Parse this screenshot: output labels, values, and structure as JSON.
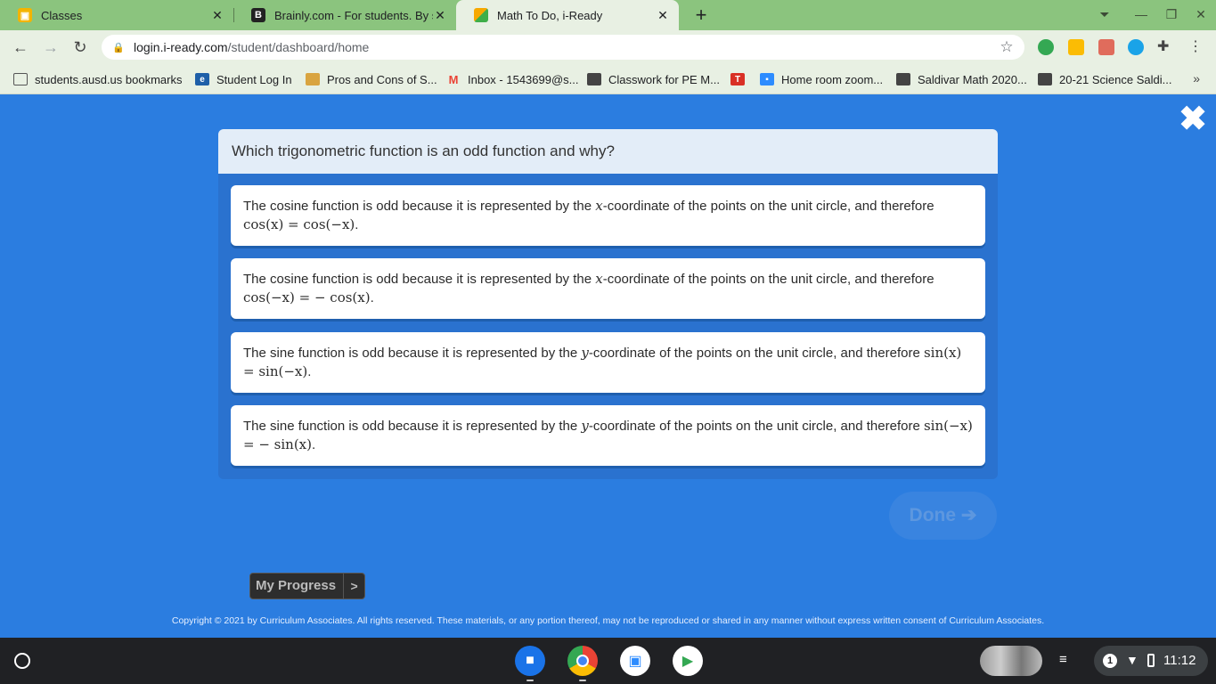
{
  "browser": {
    "tabs": [
      {
        "title": "Classes",
        "active": false
      },
      {
        "title": "Brainly.com - For students. By st",
        "active": false
      },
      {
        "title": "Math To Do, i-Ready",
        "active": true
      }
    ],
    "new_tab": "+",
    "url_host": "login.i-ready.com",
    "url_path": "/student/dashboard/home"
  },
  "bookmarks": [
    "students.ausd.us bookmarks",
    "Student Log In",
    "Pros and Cons of S...",
    "Inbox - 1543699@s...",
    "Classwork for PE M...",
    "",
    "Home room zoom...",
    "Saldivar Math 2020...",
    "20-21 Science Saldi..."
  ],
  "bookmarks_more": "»",
  "question": {
    "prompt": "Which trigonometric function is an odd function and why?",
    "options": [
      {
        "text": "The cosine function is odd because it is represented by the ",
        "var": "x",
        "rest": "-coordinate of the points on the unit circle, and therefore ",
        "math": "cos(x) = cos(−x)",
        "end": "."
      },
      {
        "text": "The cosine function is odd because it is represented by the ",
        "var": "x",
        "rest": "-coordinate of the points on the unit circle, and therefore ",
        "math": "cos(−x) = − cos(x)",
        "end": "."
      },
      {
        "text": "The sine function is odd because it is represented by the ",
        "var": "y",
        "rest": "-coordinate of the points on the unit circle, and therefore ",
        "math": "sin(x) = sin(−x)",
        "end": "."
      },
      {
        "text": "The sine function is odd because it is represented by the ",
        "var": "y",
        "rest": "-coordinate of the points on the unit circle, and therefore ",
        "math": "sin(−x) = − sin(x)",
        "end": "."
      }
    ]
  },
  "done_label": "Done ➔",
  "progress_label": "My Progress",
  "progress_arrow": ">",
  "copyright": "Copyright © 2021 by Curriculum Associates. All rights reserved. These materials, or any portion thereof, may not be reproduced or shared in any manner without express written consent of Curriculum Associates.",
  "shelf": {
    "time": "11:12",
    "notification_count": "1"
  },
  "colors": {
    "page_bg": "#2b7de0",
    "tab_bar": "#8bc47e"
  }
}
